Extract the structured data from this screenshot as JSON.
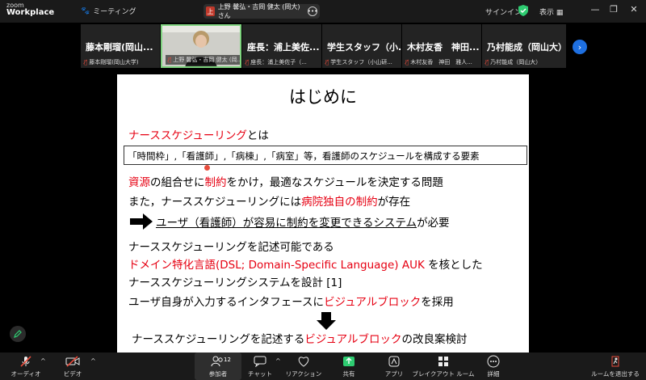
{
  "app": {
    "logo_top": "zoom",
    "logo_bottom": "Workplace",
    "meeting_label": "ミーティング",
    "speaker": {
      "initial": "上",
      "name": "上野 馨弘・吉岡 健太 (岡大) さん"
    },
    "signin": "サインイン",
    "view": "表示",
    "colors": {
      "accent_blue": "#1e6fe0",
      "green": "#2ecc71",
      "mute_red": "#e74c3c",
      "slide_red": "#e60012"
    }
  },
  "participants": [
    {
      "display": "藤本剛瑠(岡山...",
      "label": "藤本剛瑠(岡山大学)"
    },
    {
      "display": "",
      "label": "上野 馨弘・吉岡 健太 (岡..."
    },
    {
      "display": "座長：浦上美佐...",
      "label": "座長：浦上美佐子（..."
    },
    {
      "display": "学生スタッフ（小...",
      "label": "学生スタッフ（小山研..."
    },
    {
      "display": "木村友香　神田...",
      "label": "木村友香　神田　雅人..."
    },
    {
      "display": "乃村能成（岡山大）",
      "label": "乃村能成（岡山大）"
    }
  ],
  "slide": {
    "title": "はじめに",
    "l1_red": "ナーススケジューリング",
    "l1_rest": "とは",
    "box": "「時間枠」,「看護師」,「病棟」,「病室」等，看護師のスケジュールを構成する要素",
    "l3_red1": "資源",
    "l3_mid": "の組合せに",
    "l3_red2": "制約",
    "l3_rest": "をかけ，最適なスケジュールを決定する問題",
    "l4_pre": "また，ナーススケジューリングには",
    "l4_red": "病院独自の制約",
    "l4_post": "が存在",
    "l5": "ユーザ（看護師）が容易に制約を変更できるシステム",
    "l5_post": "が必要",
    "l6": "ナーススケジューリングを記述可能である",
    "l7_red": "ドメイン特化言語(DSL; Domain-Specific Language) AUK",
    "l7_post": "を核とした",
    "l8": "ナーススケジューリングシステムを設計 [1]",
    "l9_pre": "ユーザ自身が入力するインタフェースに",
    "l9_red": "ビジュアルブロック",
    "l9_post": "を採用",
    "l10_pre": "ナーススケジューリングを記述する",
    "l10_red": "ビジュアルブロック",
    "l10_post": "の改良案検討"
  },
  "toolbar": {
    "audio": "オーディオ",
    "video": "ビデオ",
    "participants": "参加者",
    "participant_count": "12",
    "chat": "チャット",
    "reactions": "リアクション",
    "share": "共有",
    "apps": "アプリ",
    "breakout": "ブレイクアウト ルーム",
    "more": "詳細",
    "leave": "ルームを退出する"
  }
}
